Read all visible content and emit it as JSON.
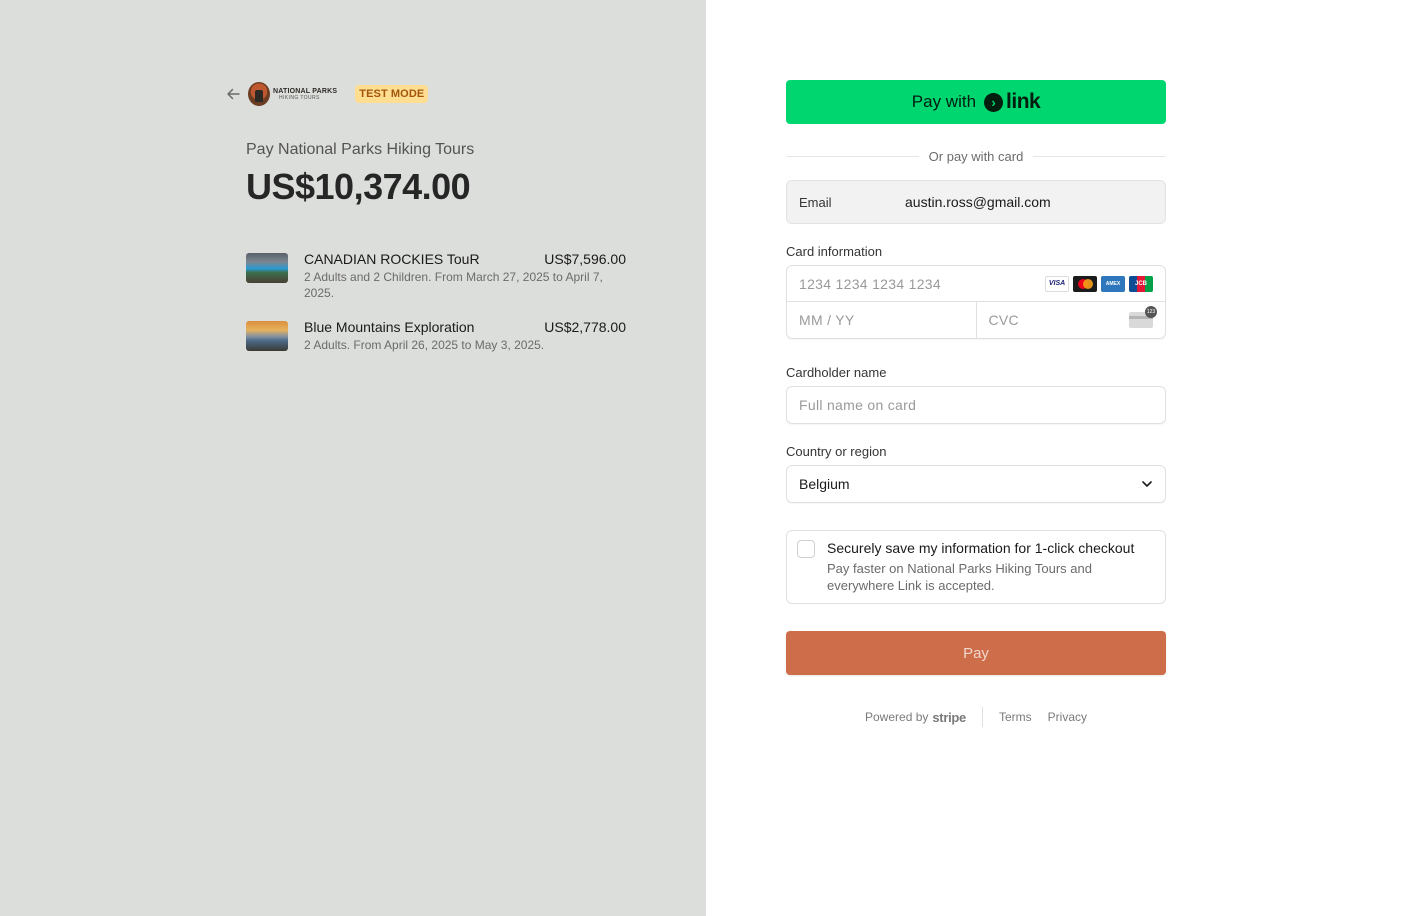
{
  "header": {
    "logo_line1": "NATIONAL PARKS",
    "logo_line2": "HIKING TOURS",
    "test_mode_badge": "TEST MODE"
  },
  "summary": {
    "merchant_line": "Pay National Parks Hiking Tours",
    "total": "US$10,374.00",
    "items": [
      {
        "name": "CANADIAN ROCKIES TouR",
        "price": "US$7,596.00",
        "description": "2 Adults and 2 Children. From March 27, 2025 to April 7, 2025."
      },
      {
        "name": "Blue Mountains Exploration",
        "price": "US$2,778.00",
        "description": "2 Adults. From April 26, 2025 to May 3, 2025."
      }
    ]
  },
  "form": {
    "link_button_prefix": "Pay with",
    "link_word": "link",
    "divider_text": "Or pay with card",
    "email_label": "Email",
    "email_value": "austin.ross@gmail.com",
    "card_info_label": "Card information",
    "card_number_placeholder": "1234 1234 1234 1234",
    "expiry_placeholder": "MM / YY",
    "cvc_placeholder": "CVC",
    "card_brands": [
      "VISA",
      "Mastercard",
      "AMEX",
      "JCB"
    ],
    "cardholder_label": "Cardholder name",
    "cardholder_placeholder": "Full name on card",
    "country_label": "Country or region",
    "country_value": "Belgium",
    "save_title": "Securely save my information for 1-click checkout",
    "save_description": "Pay faster on National Parks Hiking Tours and everywhere Link is accepted.",
    "pay_button": "Pay"
  },
  "footer": {
    "powered_by": "Powered by",
    "stripe": "stripe",
    "terms": "Terms",
    "privacy": "Privacy"
  },
  "colors": {
    "left_bg": "#dcdedb",
    "link_green": "#00d66f",
    "pay_button": "#cd6d4a",
    "test_mode_bg": "#ffde92"
  }
}
